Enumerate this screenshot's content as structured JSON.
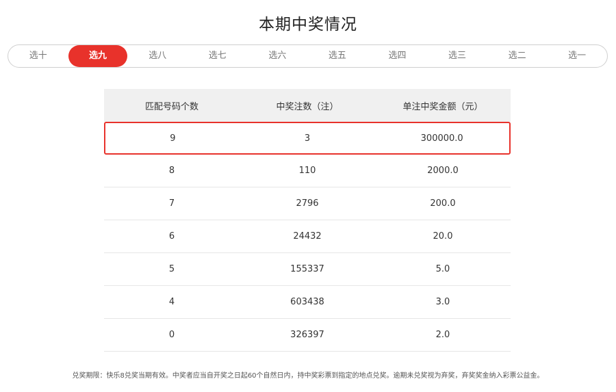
{
  "page": {
    "title": "本期中奖情况"
  },
  "tabs": [
    {
      "label": "选十",
      "active": false
    },
    {
      "label": "选九",
      "active": true
    },
    {
      "label": "选八",
      "active": false
    },
    {
      "label": "选七",
      "active": false
    },
    {
      "label": "选六",
      "active": false
    },
    {
      "label": "选五",
      "active": false
    },
    {
      "label": "选四",
      "active": false
    },
    {
      "label": "选三",
      "active": false
    },
    {
      "label": "选二",
      "active": false
    },
    {
      "label": "选一",
      "active": false
    }
  ],
  "table": {
    "headers": [
      "匹配号码个数",
      "中奖注数（注）",
      "单注中奖金额（元）"
    ],
    "rows": [
      {
        "match": "9",
        "count": "3",
        "amount": "300000.0",
        "highlight": true
      },
      {
        "match": "8",
        "count": "110",
        "amount": "2000.0"
      },
      {
        "match": "7",
        "count": "2796",
        "amount": "200.0"
      },
      {
        "match": "6",
        "count": "24432",
        "amount": "20.0"
      },
      {
        "match": "5",
        "count": "155337",
        "amount": "5.0"
      },
      {
        "match": "4",
        "count": "603438",
        "amount": "3.0"
      },
      {
        "match": "0",
        "count": "326397",
        "amount": "2.0"
      }
    ]
  },
  "footer": {
    "note": "兑奖期限：快乐8兑奖当期有效。中奖者应当自开奖之日起60个自然日内，持中奖彩票到指定的地点兑奖。逾期未兑奖视为弃奖，弃奖奖金纳入彩票公益金。"
  },
  "colors": {
    "accent": "#e8322b",
    "header_bg": "#f0f0f0"
  }
}
